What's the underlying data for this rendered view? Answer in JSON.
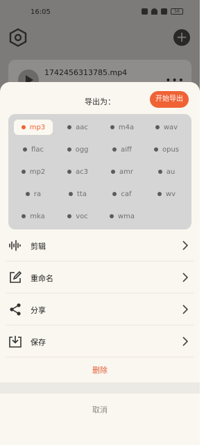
{
  "status_bar": {
    "time": "16:05",
    "battery": "56"
  },
  "background_app": {
    "file_name": "1742456313785.mp4"
  },
  "sheet": {
    "export_label": "导出为：",
    "start_button": "开始导出",
    "formats": [
      {
        "label": "mp3",
        "selected": true
      },
      {
        "label": "aac"
      },
      {
        "label": "m4a"
      },
      {
        "label": "wav"
      },
      {
        "label": "flac"
      },
      {
        "label": "ogg"
      },
      {
        "label": "aiff"
      },
      {
        "label": "opus"
      },
      {
        "label": "mp2"
      },
      {
        "label": "ac3"
      },
      {
        "label": "amr"
      },
      {
        "label": "au"
      },
      {
        "label": "ra"
      },
      {
        "label": "tta"
      },
      {
        "label": "caf"
      },
      {
        "label": "wv"
      },
      {
        "label": "mka"
      },
      {
        "label": "voc"
      },
      {
        "label": "wma"
      }
    ],
    "menu": [
      {
        "label": "剪辑",
        "icon": "waveform-icon"
      },
      {
        "label": "重命名",
        "icon": "edit-icon"
      },
      {
        "label": "分享",
        "icon": "share-icon"
      },
      {
        "label": "保存",
        "icon": "download-icon"
      }
    ],
    "delete_label": "删除",
    "cancel_label": "取消"
  },
  "colors": {
    "accent": "#ef6236",
    "sheet_bg": "#faf7f0",
    "format_panel_bg": "#d5d5d5"
  }
}
